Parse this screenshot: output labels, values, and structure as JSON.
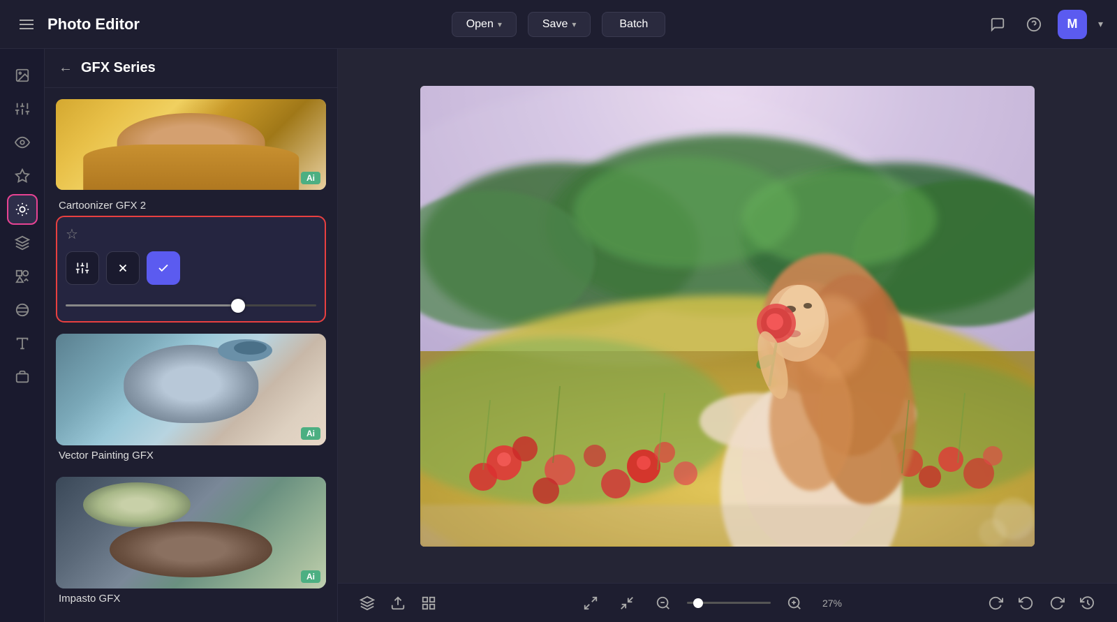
{
  "app": {
    "title": "Photo Editor",
    "hamburger_label": "menu"
  },
  "header": {
    "open_label": "Open",
    "save_label": "Save",
    "batch_label": "Batch",
    "open_chevron": "▾",
    "save_chevron": "▾"
  },
  "header_right": {
    "chat_icon": "💬",
    "help_icon": "?",
    "user_initial": "M",
    "user_chevron": "▾"
  },
  "panel": {
    "back_label": "←",
    "title": "GFX Series"
  },
  "filters": [
    {
      "name": "Cartoonizer GFX 2",
      "ai": "Ai",
      "selected": true
    },
    {
      "name": "Vector Painting GFX",
      "ai": "Ai",
      "selected": false
    },
    {
      "name": "Impasto GFX",
      "ai": "Ai",
      "selected": false
    }
  ],
  "filter_controls": {
    "settings_icon": "⊕",
    "cancel_icon": "✕",
    "confirm_icon": "✓",
    "star_icon": "☆"
  },
  "bottom_toolbar": {
    "layers_icon": "layers",
    "export_icon": "export",
    "grid_icon": "grid",
    "fit_icon": "fit",
    "zoom_fit_icon": "zoom-fit",
    "zoom_out_icon": "−",
    "zoom_in_icon": "+",
    "zoom_value": "27%",
    "rotate_icon": "rotate",
    "undo_icon": "undo",
    "redo_icon": "redo",
    "history_icon": "history"
  },
  "rail": {
    "items": [
      {
        "icon": "image",
        "label": "image",
        "active": false
      },
      {
        "icon": "sliders",
        "label": "adjustments",
        "active": false
      },
      {
        "icon": "eye",
        "label": "view",
        "active": false
      },
      {
        "icon": "sparkle",
        "label": "effects",
        "active": false
      },
      {
        "icon": "effect-active",
        "label": "art-effects",
        "active": true
      },
      {
        "icon": "layers",
        "label": "layers",
        "active": false
      },
      {
        "icon": "shapes",
        "label": "shapes",
        "active": false
      },
      {
        "icon": "texture",
        "label": "texture",
        "active": false
      },
      {
        "icon": "text",
        "label": "text",
        "active": false
      },
      {
        "icon": "watermark",
        "label": "watermark",
        "active": false
      }
    ]
  }
}
